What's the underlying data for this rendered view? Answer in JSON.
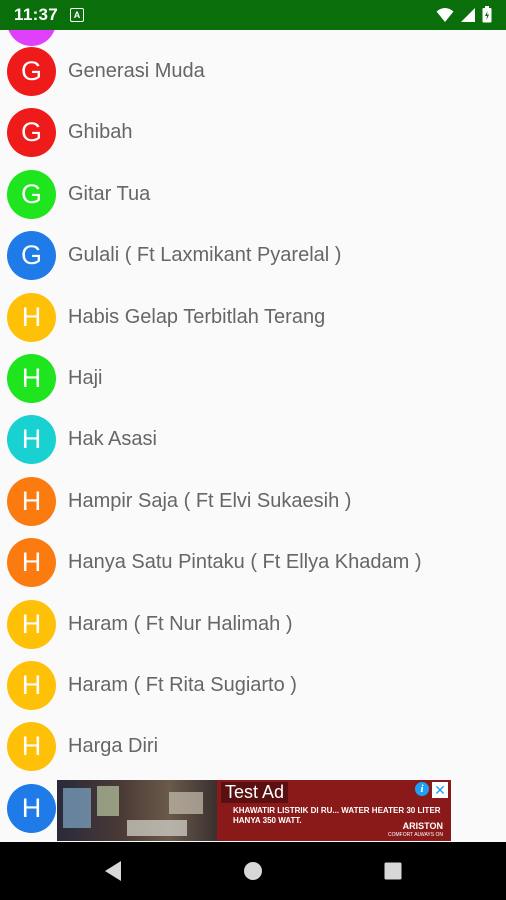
{
  "status_bar": {
    "time": "11:37",
    "notification_letter": "A",
    "icons": [
      "wifi-icon",
      "signal-icon",
      "battery-icon"
    ]
  },
  "list": {
    "items": [
      {
        "letter": "G",
        "title": "Generasi Muda",
        "color": "#ef1a1a"
      },
      {
        "letter": "G",
        "title": "Ghibah",
        "color": "#ef1a1a"
      },
      {
        "letter": "G",
        "title": "Gitar Tua",
        "color": "#1ee51e"
      },
      {
        "letter": "G",
        "title": "Gulali ( Ft Laxmikant Pyarelal )",
        "color": "#1f7be8"
      },
      {
        "letter": "H",
        "title": "Habis Gelap Terbitlah Terang",
        "color": "#ffc107"
      },
      {
        "letter": "H",
        "title": "Haji",
        "color": "#1ee51e"
      },
      {
        "letter": "H",
        "title": "Hak Asasi",
        "color": "#19d1d1"
      },
      {
        "letter": "H",
        "title": "Hampir Saja ( Ft Elvi Sukaesih )",
        "color": "#fb7b10"
      },
      {
        "letter": "H",
        "title": "Hanya Satu Pintaku ( Ft Ellya Khadam )",
        "color": "#fb7b10"
      },
      {
        "letter": "H",
        "title": "Haram ( Ft Nur Halimah )",
        "color": "#ffc107"
      },
      {
        "letter": "H",
        "title": "Haram ( Ft Rita Sugiarto )",
        "color": "#ffc107"
      },
      {
        "letter": "H",
        "title": "Harga Diri",
        "color": "#ffc107"
      },
      {
        "letter": "H",
        "title": "",
        "color": "#1f7be8"
      }
    ],
    "partial_top_avatar_color": "#e040fb"
  },
  "ad": {
    "label": "Test Ad",
    "text": "KHAWATIR LISTRIK DI RU... WATER HEATER 30 LITER HANYA 350 WATT.",
    "brand": "ARISTON",
    "brand_sub": "COMFORT ALWAYS ON",
    "info_symbol": "i",
    "close_symbol": "✕"
  },
  "nav_bar": {
    "buttons": [
      "back",
      "home",
      "recents"
    ]
  }
}
